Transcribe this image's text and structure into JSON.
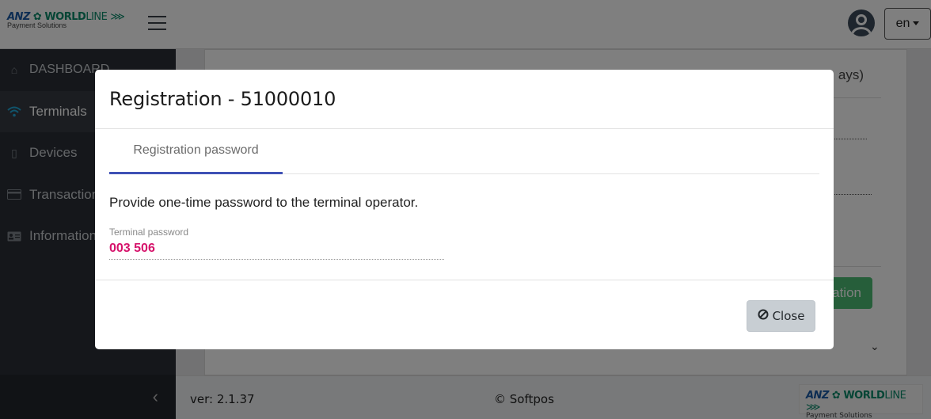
{
  "header": {
    "logo": {
      "anz": "ANZ",
      "worldline_bold": "WORLD",
      "worldline_light": "LINE",
      "subtitle": "Payment Solutions"
    },
    "menu_icon": "hamburger-icon",
    "user_icon": "user-circle-icon",
    "language": {
      "selected": "en"
    }
  },
  "sidebar": {
    "items": [
      {
        "label": "DASHBOARD",
        "icon": "home-icon",
        "active": false
      },
      {
        "label": "Terminals",
        "icon": "wifi-icon",
        "active": true
      },
      {
        "label": "Devices",
        "icon": "mobile-icon",
        "active": false
      },
      {
        "label": "Transactions",
        "icon": "credit-card-icon",
        "active": false
      },
      {
        "label": "Information",
        "icon": "id-card-icon",
        "active": false
      }
    ],
    "collapse_icon": "chevron-left-icon"
  },
  "background": {
    "header_fragment": "ays)",
    "button_fragment": "ation",
    "expand_icon": "chevron-down-icon"
  },
  "footer": {
    "version": "ver: 2.1.37",
    "copyright": "© Softpos"
  },
  "modal": {
    "title": "Registration - 51000010",
    "tabs": [
      {
        "label": "Registration password",
        "active": true
      }
    ],
    "description": "Provide one-time password to the terminal operator.",
    "field": {
      "label": "Terminal password",
      "value": "003 506"
    },
    "close_button": {
      "label": "Close",
      "icon": "ban-icon"
    },
    "accent_color": "#3f51b5",
    "password_color": "#d6136b"
  }
}
